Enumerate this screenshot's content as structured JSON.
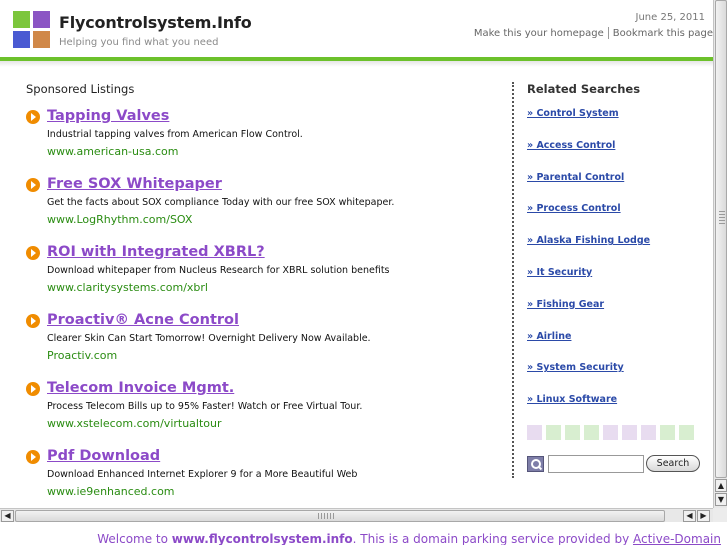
{
  "header": {
    "title": "Flycontrolsystem.Info",
    "tagline": "Helping you find what you need",
    "date": "June 25, 2011",
    "homepage_link": "Make this your homepage",
    "bookmark_link": "Bookmark this page",
    "logo_colors": [
      "#7cc63c",
      "#8b55c4",
      "#4a5ad2",
      "#d08848"
    ]
  },
  "listings": {
    "title": "Sponsored Listings",
    "ads": [
      {
        "title": "Tapping Valves",
        "desc": "Industrial tapping valves from American Flow Control.",
        "url": "www.american-usa.com"
      },
      {
        "title": "Free SOX Whitepaper",
        "desc": "Get the facts about SOX compliance Today with our free SOX whitepaper.",
        "url": "www.LogRhythm.com/SOX"
      },
      {
        "title": "ROI with Integrated XBRL?",
        "desc": "Download whitepaper from Nucleus Research for XBRL solution benefits",
        "url": "www.claritysystems.com/xbrl"
      },
      {
        "title": "Proactiv® Acne Control",
        "desc": "Clearer Skin Can Start Tomorrow! Overnight Delivery Now Available.",
        "url": "Proactiv.com"
      },
      {
        "title": "Telecom Invoice Mgmt.",
        "desc": "Process Telecom Bills up to 95% Faster! Watch or Free Virtual Tour.",
        "url": "www.xstelecom.com/virtualtour"
      },
      {
        "title": "Pdf Download",
        "desc": "Download Enhanced Internet Explorer 9 for a More Beautiful Web",
        "url": "www.ie9enhanced.com"
      }
    ]
  },
  "related": {
    "title": "Related Searches",
    "items": [
      "» Control System",
      "» Access Control",
      "» Parental Control",
      "» Process Control",
      "» Alaska Fishing Lodge",
      "» It Security",
      "» Fishing Gear",
      "» Airline",
      "» System Security",
      "» Linux Software"
    ],
    "swatch_colors": [
      "#e8dcf0",
      "#d8eed0",
      "#d8eed0",
      "#d8eed0",
      "#e8dcf0",
      "#e8dcf0",
      "#e8dcf0",
      "#d8eed0",
      "#d8eed0"
    ],
    "search_button": "Search",
    "search_value": ""
  },
  "footer": {
    "prefix": "Welcome to ",
    "domain": "www.flycontrolsystem.info",
    "middle": ". This is a domain parking service provided by ",
    "provider": "Active-Domain"
  },
  "colors": {
    "accent_green": "#6cc12b",
    "link_purple": "#8c4ac8",
    "url_green": "#2a8c12",
    "related_blue": "#2b4aa8",
    "bullet_orange": "#f08c00"
  }
}
